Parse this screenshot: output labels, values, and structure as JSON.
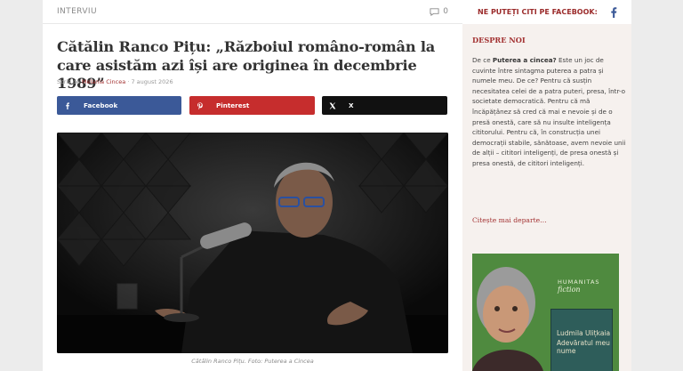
{
  "article": {
    "category": "INTERVIU",
    "comment_count": "0",
    "title": "Cătălin Ranco Pițu: „Războiul româno-român la care asistăm azi își are originea în decembrie 1989”",
    "byline_prefix": "Scris de",
    "author": "Melania Cincea",
    "date_sep": "·",
    "date": "7 august 2026",
    "caption": "Cătălin Ranco Pițu. Foto: Puterea a Cincea"
  },
  "share": {
    "facebook": "Facebook",
    "pinterest": "Pinterest",
    "x": "X"
  },
  "sidebar": {
    "facebook_heading": "NE PUTEȚI CITI PE FACEBOOK:",
    "about_heading": "DESPRE NOI",
    "about_intro": "De ce ",
    "about_bold": "Puterea a cincea?",
    "about_rest": " Este un joc de cuvinte între sintagma puterea a patra și numele meu. De ce? Pentru că susțin necesitatea celei de a patra puteri, presa, într-o societate democratică. Pentru că mă încăpățânez să cred că mai e nevoie și de o presă onestă, care să nu insulte inteligența cititorului. Pentru că, în construcția unei democrații stabile, sănătoase, avem nevoie unii de alții – cititori inteligenți, de presa onestă și presa onestă, de cititori inteligenți.",
    "read_more": "Citește mai departe…",
    "ad_brand": "HUMANITAS",
    "ad_brand_sub": "fiction",
    "ad_author": "Ludmila Ulițkaia",
    "ad_book_title": "Adevăratul meu nume"
  },
  "colors": {
    "accent": "#a33232",
    "facebook": "#3b5998",
    "pinterest": "#c62d2d",
    "x": "#111111"
  }
}
